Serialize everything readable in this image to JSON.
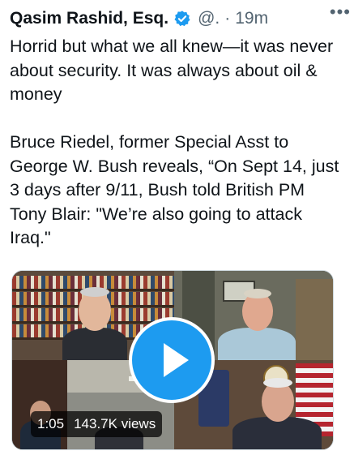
{
  "tweet": {
    "author_name": "Qasim Rashid, Esq.",
    "handle": "@.",
    "separator": "·",
    "time": "19m",
    "more_glyph": "•••",
    "paragraphs": [
      "Horrid but what we all knew—it was never about security. It was always about oil & money",
      "Bruce Riedel, former Special Asst to George W. Bush reveals, “On Sept 14, just 3 days after 9/11, Bush told British PM Tony Blair: \"We’re also going to attack Iraq.\""
    ]
  },
  "video": {
    "duration": "1:05",
    "views": "143.7K views",
    "play_icon": "play-icon"
  },
  "colors": {
    "accent": "#1d9bf0",
    "text": "#0f1419",
    "secondary_text": "#536471"
  }
}
